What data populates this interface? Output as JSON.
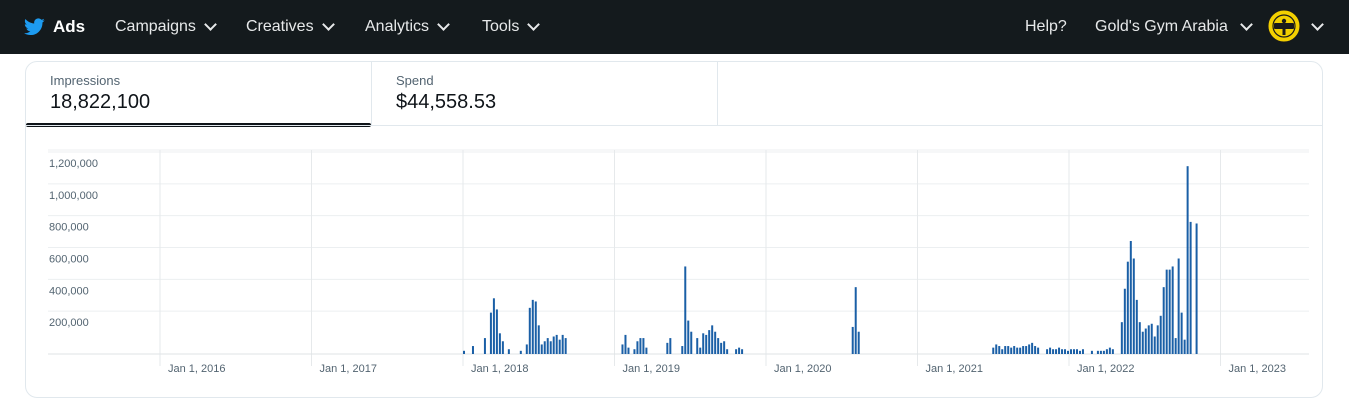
{
  "nav": {
    "brand": "Ads",
    "menus": [
      {
        "label": "Campaigns"
      },
      {
        "label": "Creatives"
      },
      {
        "label": "Analytics"
      },
      {
        "label": "Tools"
      }
    ],
    "help": "Help?",
    "account": "Gold's Gym Arabia",
    "colors": {
      "bar": "#141a1d",
      "twitter_blue": "#1d9bf0",
      "avatar_yellow": "#f3d000"
    }
  },
  "metrics": [
    {
      "label": "Impressions",
      "value": "18,822,100",
      "active": true
    },
    {
      "label": "Spend",
      "value": "$44,558.53",
      "active": false
    }
  ],
  "chart_data": {
    "type": "bar",
    "series_color": "#1a5fa6",
    "grid": true,
    "ylim": [
      0,
      1200000
    ],
    "y_ticks": [
      "200,000",
      "400,000",
      "600,000",
      "800,000",
      "1,000,000",
      "1,200,000"
    ],
    "y_tick_values": [
      200000,
      400000,
      600000,
      800000,
      1000000,
      1200000
    ],
    "x_ticks": [
      "Jan 1, 2016",
      "Jan 1, 2017",
      "Jan 1, 2018",
      "Jan 1, 2019",
      "Jan 1, 2020",
      "Jan 1, 2021",
      "Jan 1, 2022",
      "Jan 1, 2023"
    ],
    "x_tick_values": [
      2016.0,
      2017.0,
      2018.0,
      2019.0,
      2020.0,
      2021.0,
      2022.0,
      2023.0
    ],
    "x": [
      2016.0,
      2016.5,
      2017.0,
      2017.5,
      2018.0,
      2018.5,
      2019.0,
      2019.5,
      2020.0,
      2020.5,
      2021.0,
      2021.5,
      2022.0,
      2022.5,
      2023.0
    ],
    "xlim": [
      2015.0,
      2023.5
    ],
    "x_start": 2015.0,
    "x_step": 0.019737,
    "bars": [
      [
        152,
        20000
      ],
      [
        155,
        50000
      ],
      [
        159,
        100000
      ],
      [
        161,
        260000
      ],
      [
        162,
        350000
      ],
      [
        163,
        280000
      ],
      [
        164,
        130000
      ],
      [
        165,
        80000
      ],
      [
        167,
        30000
      ],
      [
        171,
        20000
      ],
      [
        173,
        60000
      ],
      [
        174,
        290000
      ],
      [
        175,
        340000
      ],
      [
        176,
        330000
      ],
      [
        177,
        180000
      ],
      [
        178,
        60000
      ],
      [
        179,
        80000
      ],
      [
        180,
        100000
      ],
      [
        181,
        80000
      ],
      [
        182,
        110000
      ],
      [
        183,
        120000
      ],
      [
        184,
        90000
      ],
      [
        185,
        120000
      ],
      [
        186,
        100000
      ],
      [
        205,
        60000
      ],
      [
        206,
        120000
      ],
      [
        207,
        40000
      ],
      [
        209,
        30000
      ],
      [
        210,
        80000
      ],
      [
        211,
        100000
      ],
      [
        212,
        100000
      ],
      [
        213,
        40000
      ],
      [
        220,
        70000
      ],
      [
        221,
        100000
      ],
      [
        225,
        50000
      ],
      [
        226,
        550000
      ],
      [
        227,
        210000
      ],
      [
        228,
        140000
      ],
      [
        230,
        100000
      ],
      [
        231,
        40000
      ],
      [
        232,
        130000
      ],
      [
        233,
        120000
      ],
      [
        234,
        150000
      ],
      [
        235,
        180000
      ],
      [
        236,
        140000
      ],
      [
        237,
        100000
      ],
      [
        238,
        70000
      ],
      [
        239,
        80000
      ],
      [
        240,
        30000
      ],
      [
        243,
        30000
      ],
      [
        244,
        40000
      ],
      [
        245,
        30000
      ],
      [
        282,
        170000
      ],
      [
        283,
        420000
      ],
      [
        284,
        140000
      ],
      [
        329,
        40000
      ],
      [
        330,
        60000
      ],
      [
        331,
        50000
      ],
      [
        332,
        30000
      ],
      [
        333,
        50000
      ],
      [
        334,
        50000
      ],
      [
        335,
        40000
      ],
      [
        336,
        50000
      ],
      [
        337,
        40000
      ],
      [
        338,
        40000
      ],
      [
        339,
        50000
      ],
      [
        340,
        50000
      ],
      [
        341,
        60000
      ],
      [
        342,
        70000
      ],
      [
        343,
        50000
      ],
      [
        344,
        40000
      ],
      [
        347,
        30000
      ],
      [
        348,
        40000
      ],
      [
        349,
        30000
      ],
      [
        350,
        30000
      ],
      [
        351,
        40000
      ],
      [
        352,
        30000
      ],
      [
        353,
        30000
      ],
      [
        354,
        20000
      ],
      [
        355,
        30000
      ],
      [
        356,
        30000
      ],
      [
        357,
        30000
      ],
      [
        358,
        20000
      ],
      [
        359,
        30000
      ],
      [
        362,
        20000
      ],
      [
        364,
        20000
      ],
      [
        365,
        20000
      ],
      [
        366,
        20000
      ],
      [
        367,
        30000
      ],
      [
        368,
        40000
      ],
      [
        369,
        30000
      ],
      [
        372,
        200000
      ],
      [
        373,
        410000
      ],
      [
        374,
        580000
      ],
      [
        375,
        710000
      ],
      [
        376,
        600000
      ],
      [
        377,
        340000
      ],
      [
        378,
        200000
      ],
      [
        379,
        140000
      ],
      [
        380,
        160000
      ],
      [
        381,
        180000
      ],
      [
        382,
        190000
      ],
      [
        383,
        110000
      ],
      [
        384,
        180000
      ],
      [
        385,
        240000
      ],
      [
        386,
        420000
      ],
      [
        387,
        530000
      ],
      [
        388,
        530000
      ],
      [
        389,
        550000
      ],
      [
        390,
        100000
      ],
      [
        391,
        600000
      ],
      [
        392,
        260000
      ],
      [
        393,
        90000
      ],
      [
        394,
        1180000
      ],
      [
        395,
        830000
      ],
      [
        397,
        820000
      ]
    ]
  }
}
